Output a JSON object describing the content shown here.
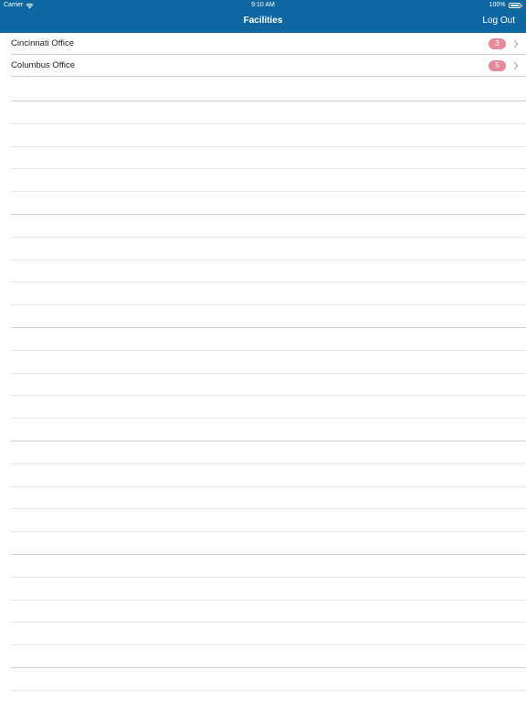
{
  "status_bar": {
    "carrier": "Carrier",
    "time": "9:10 AM",
    "battery": "100%"
  },
  "nav": {
    "title": "Facilities",
    "logout_label": "Log Out"
  },
  "facilities": [
    {
      "name": "Cincinnati Office",
      "count": "3"
    },
    {
      "name": "Columbus Office",
      "count": "5"
    }
  ],
  "colors": {
    "header_bg": "#0e67a0",
    "badge": "#e58a99"
  }
}
